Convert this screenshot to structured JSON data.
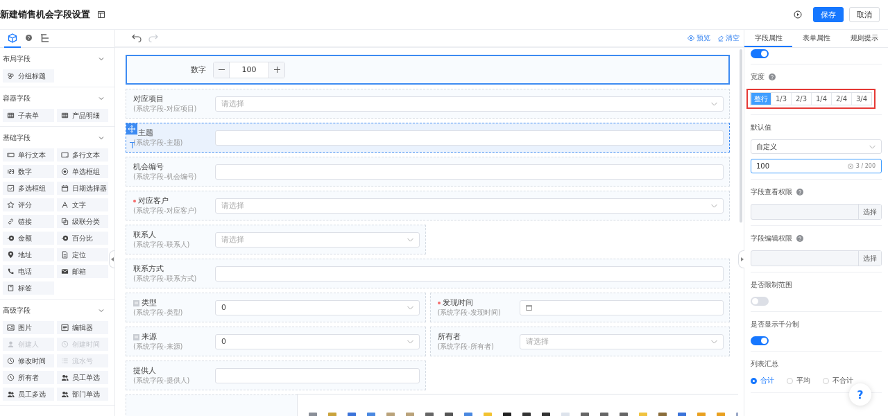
{
  "header": {
    "title": "新建销售机会字段设置",
    "save": "保存",
    "cancel": "取消"
  },
  "palette": {
    "tabs": [
      {
        "selected": true
      },
      {
        "selected": false
      },
      {
        "selected": false
      }
    ],
    "sections": [
      {
        "title": "布局字段",
        "expanded": true,
        "items": [
          {
            "label": "分组标题",
            "disabled": false
          }
        ]
      },
      {
        "title": "容器字段",
        "expanded": true,
        "items": [
          {
            "label": "子表单",
            "disabled": false
          },
          {
            "label": "产品明细",
            "disabled": false
          }
        ]
      },
      {
        "title": "基础字段",
        "expanded": true,
        "items": [
          {
            "label": "单行文本",
            "disabled": false
          },
          {
            "label": "多行文本",
            "disabled": false
          },
          {
            "label": "数字",
            "disabled": false
          },
          {
            "label": "单选框组",
            "disabled": false
          },
          {
            "label": "多选框组",
            "disabled": false
          },
          {
            "label": "日期选择器",
            "disabled": false
          },
          {
            "label": "评分",
            "disabled": false
          },
          {
            "label": "文字",
            "disabled": false
          },
          {
            "label": "链接",
            "disabled": false
          },
          {
            "label": "级联分类",
            "disabled": false
          },
          {
            "label": "金额",
            "disabled": false
          },
          {
            "label": "百分比",
            "disabled": false
          },
          {
            "label": "地址",
            "disabled": false
          },
          {
            "label": "定位",
            "disabled": false
          },
          {
            "label": "电话",
            "disabled": false
          },
          {
            "label": "邮箱",
            "disabled": false
          },
          {
            "label": "标签",
            "disabled": false
          }
        ]
      },
      {
        "title": "高级字段",
        "expanded": true,
        "items": [
          {
            "label": "图片",
            "disabled": false
          },
          {
            "label": "编辑器",
            "disabled": false
          },
          {
            "label": "创建人",
            "disabled": true
          },
          {
            "label": "创建时间",
            "disabled": true
          },
          {
            "label": "修改时间",
            "disabled": false
          },
          {
            "label": "流水号",
            "disabled": true
          },
          {
            "label": "所有者",
            "disabled": false
          },
          {
            "label": "员工单选",
            "disabled": false
          },
          {
            "label": "员工多选",
            "disabled": false
          },
          {
            "label": "部门单选",
            "disabled": false
          }
        ]
      }
    ]
  },
  "canvas": {
    "preview": "预览",
    "clear": "清空",
    "redo_disabled": true,
    "rows": [
      {
        "fields": [
          {
            "kind": "number",
            "label": "数字",
            "value": "100",
            "half": false,
            "required": false,
            "selected": true,
            "hovered": false,
            "flagged": false
          }
        ]
      },
      {
        "fields": [
          {
            "kind": "select",
            "label": "对应项目",
            "sublabel": "(系统字段-对应项目)",
            "placeholder": "请选择",
            "half": false,
            "required": false,
            "selected": false,
            "hovered": false,
            "flagged": false
          }
        ]
      },
      {
        "fields": [
          {
            "kind": "input",
            "label": "主题",
            "sublabel": "(系统字段-主题)",
            "half": false,
            "required": true,
            "selected": false,
            "hovered": true,
            "type_mark": "T",
            "flagged": false
          }
        ]
      },
      {
        "fields": [
          {
            "kind": "input",
            "label": "机会编号",
            "sublabel": "(系统字段-机会编号)",
            "half": false,
            "required": false,
            "selected": false,
            "hovered": false,
            "flagged": false
          }
        ]
      },
      {
        "fields": [
          {
            "kind": "select",
            "label": "对应客户",
            "sublabel": "(系统字段-对应客户)",
            "placeholder": "请选择",
            "half": false,
            "required": true,
            "selected": false,
            "hovered": false,
            "flagged": false
          }
        ]
      },
      {
        "fields": [
          {
            "kind": "select",
            "label": "联系人",
            "sublabel": "(系统字段-联系人)",
            "placeholder": "请选择",
            "half": true,
            "required": false,
            "selected": false,
            "hovered": false,
            "flagged": false
          }
        ]
      },
      {
        "fields": [
          {
            "kind": "input",
            "label": "联系方式",
            "sublabel": "(系统字段-联系方式)",
            "half": false,
            "required": false,
            "selected": false,
            "hovered": false,
            "flagged": false
          }
        ]
      },
      {
        "fields": [
          {
            "kind": "select",
            "label": "类型",
            "sublabel": "(系统字段-类型)",
            "value": "0",
            "half": true,
            "required": false,
            "selected": false,
            "hovered": false,
            "flagged": true
          },
          {
            "kind": "date",
            "label": "发现时间",
            "sublabel": "(系统字段-发现时间)",
            "half": true,
            "required": true,
            "selected": false,
            "hovered": false,
            "flagged": false
          }
        ]
      },
      {
        "fields": [
          {
            "kind": "select",
            "label": "来源",
            "sublabel": "(系统字段-来源)",
            "value": "0",
            "half": true,
            "required": false,
            "selected": false,
            "hovered": false,
            "flagged": true
          },
          {
            "kind": "select",
            "label": "所有者",
            "sublabel": "(系统字段-所有者)",
            "placeholder": "请选择",
            "half": true,
            "required": false,
            "selected": false,
            "hovered": false,
            "flagged": false
          }
        ]
      },
      {
        "fields": [
          {
            "kind": "input",
            "label": "提供人",
            "sublabel": "(系统字段-提供人)",
            "half": true,
            "required": false,
            "selected": false,
            "hovered": false,
            "flagged": false
          }
        ]
      },
      {
        "fields": [
          {
            "kind": "editor",
            "half": false,
            "selected": false,
            "hovered": false
          }
        ]
      }
    ]
  },
  "properties": {
    "tabs": [
      {
        "label": "字段属性",
        "selected": true
      },
      {
        "label": "表单属性",
        "selected": false
      },
      {
        "label": "规则提示",
        "selected": false
      }
    ],
    "settings": [
      {
        "kind": "toggle",
        "on": true
      },
      {
        "kind": "segmented",
        "label": "宽度",
        "help": true,
        "highlighted": true,
        "options": [
          {
            "label": "整行",
            "selected": true
          },
          {
            "label": "1/3",
            "selected": false
          },
          {
            "label": "2/3",
            "selected": false
          },
          {
            "label": "1/4",
            "selected": false
          },
          {
            "label": "2/4",
            "selected": false
          },
          {
            "label": "3/4",
            "selected": false
          }
        ]
      },
      {
        "kind": "default",
        "label": "默认值",
        "mode": "自定义",
        "value": "100",
        "count": "3 / 200"
      },
      {
        "kind": "picker",
        "label": "字段查看权限",
        "help": true,
        "button": "选择"
      },
      {
        "kind": "picker",
        "label": "字段编辑权限",
        "help": true,
        "button": "选择"
      },
      {
        "kind": "toggle",
        "label": "是否限制范围",
        "on": false
      },
      {
        "kind": "toggle",
        "label": "是否显示千分制",
        "on": true
      },
      {
        "kind": "radio",
        "label": "列表汇总",
        "options": [
          {
            "label": "合计",
            "selected": true
          },
          {
            "label": "平均",
            "selected": false
          },
          {
            "label": "不合计",
            "selected": false
          }
        ]
      }
    ]
  },
  "help_button": "?"
}
